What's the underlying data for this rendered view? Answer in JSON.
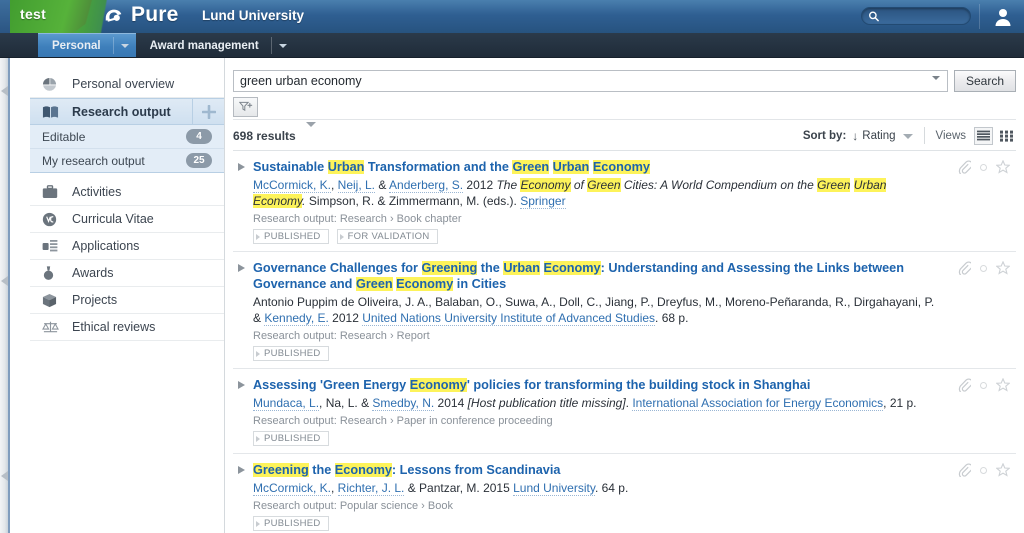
{
  "banner": {
    "env_label": "test",
    "brand_name": "Pure",
    "brand_logo_icon": "pure-swirl-logo",
    "university": "Lund University",
    "search_icon": "search-icon",
    "user_icon": "user-avatar-icon"
  },
  "tabs": [
    {
      "label": "Personal",
      "active": true,
      "caret_icon": "chevron-down-icon"
    },
    {
      "label": "Award management",
      "active": false,
      "caret_icon": "chevron-down-icon"
    }
  ],
  "sidebar": {
    "items": [
      {
        "label": "Personal overview",
        "icon": "pie-chart-icon",
        "selected": false
      },
      {
        "label": "Research output",
        "icon": "open-book-icon",
        "selected": true,
        "add_icon": "plus-icon"
      },
      {
        "label": "Activities",
        "icon": "briefcase-icon",
        "selected": false
      },
      {
        "label": "Curricula Vitae",
        "icon": "cv-circle-icon",
        "selected": false
      },
      {
        "label": "Applications",
        "icon": "applications-icon",
        "selected": false
      },
      {
        "label": "Awards",
        "icon": "award-medal-icon",
        "selected": false
      },
      {
        "label": "Projects",
        "icon": "cube-box-icon",
        "selected": false
      },
      {
        "label": "Ethical reviews",
        "icon": "balance-scales-icon",
        "selected": false
      }
    ],
    "subitems": [
      {
        "label": "Editable",
        "count": "4"
      },
      {
        "label": "My research output",
        "count": "25"
      }
    ]
  },
  "search": {
    "value": "green urban economy",
    "placeholder": "",
    "dropdown_icon": "chevron-down-icon",
    "button_label": "Search",
    "filter_icon": "add-filter-icon"
  },
  "toolbar": {
    "results_count": "698 results",
    "results_caret_icon": "chevron-down-icon",
    "sort_by_label": "Sort by:",
    "sort_direction_icon": "arrow-down-icon",
    "sort_value": "Rating",
    "sort_caret_icon": "chevron-down-icon",
    "views_label": "Views",
    "view_list_icon": "list-view-icon",
    "view_grid_icon": "grid-view-icon"
  },
  "row_icons": {
    "attachment_icon": "paperclip-icon",
    "status_icon": "circle-icon",
    "favorite_icon": "star-icon"
  },
  "results": [
    {
      "expander_icon": "triangle-right-icon",
      "title_parts": [
        {
          "t": "Sustainable ",
          "hl": false
        },
        {
          "t": "Urban",
          "hl": true
        },
        {
          "t": " Transformation and the ",
          "hl": false
        },
        {
          "t": "Green",
          "hl": true
        },
        {
          "t": " ",
          "hl": false
        },
        {
          "t": "Urban",
          "hl": true
        },
        {
          "t": " ",
          "hl": false
        },
        {
          "t": "Economy",
          "hl": true
        }
      ],
      "meta_parts": [
        {
          "t": "McCormick, K.",
          "link": true
        },
        {
          "t": ", ",
          "link": false
        },
        {
          "t": "Neij, L.",
          "link": true
        },
        {
          "t": " & ",
          "link": false
        },
        {
          "t": "Anderberg, S.",
          "link": true
        },
        {
          "t": " 2012 ",
          "link": false
        },
        {
          "t": "The ",
          "italic": true
        },
        {
          "t": "Economy",
          "italic": true,
          "hl": true
        },
        {
          "t": " of ",
          "italic": true
        },
        {
          "t": "Green",
          "italic": true,
          "hl": true
        },
        {
          "t": " Cities: A World Compendium on the ",
          "italic": true
        },
        {
          "t": "Green",
          "italic": true,
          "hl": true
        },
        {
          "t": " ",
          "italic": true
        },
        {
          "t": "Urban",
          "italic": true,
          "hl": true
        },
        {
          "t": " ",
          "italic": true
        },
        {
          "t": "Economy",
          "italic": true,
          "hl": true
        },
        {
          "t": ".",
          "italic": true
        },
        {
          "t": " Simpson, R. & Zimmermann, M. (eds.). ",
          "link": false
        },
        {
          "t": "Springer",
          "link": true
        }
      ],
      "type_line": "Research output: Research › Book chapter",
      "chips": [
        "PUBLISHED",
        "FOR VALIDATION"
      ]
    },
    {
      "expander_icon": "triangle-right-icon",
      "title_parts": [
        {
          "t": "Governance Challenges for ",
          "hl": false
        },
        {
          "t": "Greening",
          "hl": true
        },
        {
          "t": " the ",
          "hl": false
        },
        {
          "t": "Urban",
          "hl": true
        },
        {
          "t": " ",
          "hl": false
        },
        {
          "t": "Economy",
          "hl": true
        },
        {
          "t": ": Understanding and Assessing the Links between Governance and ",
          "hl": false
        },
        {
          "t": "Green",
          "hl": true
        },
        {
          "t": " ",
          "hl": false
        },
        {
          "t": "Economy",
          "hl": true
        },
        {
          "t": " in Cities",
          "hl": false
        }
      ],
      "meta_parts": [
        {
          "t": "Antonio Puppim de Oliveira, J. A., Balaban, O., Suwa, A., Doll, C., Jiang, P., Dreyfus, M., Moreno-Peñaranda, R., Dirgahayani, P. & ",
          "link": false
        },
        {
          "t": "Kennedy, E.",
          "link": true
        },
        {
          "t": " 2012 ",
          "link": false
        },
        {
          "t": "United Nations University Institute of Advanced Studies",
          "link": true
        },
        {
          "t": ". 68 p.",
          "link": false
        }
      ],
      "type_line": "Research output: Research › Report",
      "chips": [
        "PUBLISHED"
      ]
    },
    {
      "expander_icon": "triangle-right-icon",
      "title_parts": [
        {
          "t": "Assessing 'Green Energy ",
          "hl": false
        },
        {
          "t": "Economy",
          "hl": true
        },
        {
          "t": "' policies for transforming the building stock in Shanghai",
          "hl": false
        }
      ],
      "meta_parts": [
        {
          "t": "Mundaca, L.",
          "link": true
        },
        {
          "t": ", Na, L. & ",
          "link": false
        },
        {
          "t": "Smedby, N.",
          "link": true
        },
        {
          "t": " 2014 ",
          "link": false
        },
        {
          "t": "[Host publication title missing]",
          "italic": true
        },
        {
          "t": ". ",
          "link": false
        },
        {
          "t": "International Association for Energy Economics",
          "link": true
        },
        {
          "t": ", 21 p.",
          "link": false
        }
      ],
      "type_line": "Research output: Research › Paper in conference proceeding",
      "chips": [
        "PUBLISHED"
      ]
    },
    {
      "expander_icon": "triangle-right-icon",
      "title_parts": [
        {
          "t": "Greening",
          "hl": true
        },
        {
          "t": " the ",
          "hl": false
        },
        {
          "t": "Economy",
          "hl": true
        },
        {
          "t": ": Lessons from Scandinavia",
          "hl": false
        }
      ],
      "meta_parts": [
        {
          "t": "McCormick, K.",
          "link": true
        },
        {
          "t": ", ",
          "link": false
        },
        {
          "t": "Richter, J. L.",
          "link": true
        },
        {
          "t": " & Pantzar, M. 2015 ",
          "link": false
        },
        {
          "t": "Lund University",
          "link": true
        },
        {
          "t": ". 64 p.",
          "link": false
        }
      ],
      "type_line": "Research output: Popular science › Book",
      "chips": [
        "PUBLISHED"
      ]
    }
  ],
  "colors": {
    "banner_blue": "#2f5f92",
    "banner_green": "#4aa836",
    "tab_active": "#3e7fbb",
    "link_blue": "#1d63ad",
    "highlight_yellow": "#fdf35a",
    "badge_grey": "#8c9aa8"
  }
}
